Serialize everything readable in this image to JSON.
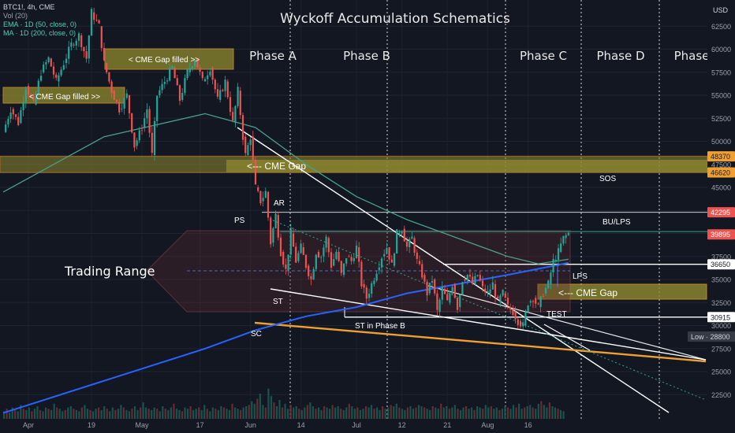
{
  "legend": {
    "symbol": "BTC1!, 4h, CME",
    "volume": "Vol (20)",
    "ema": "EMA · 1D (50, close, 0)",
    "ma": "MA · 1D (200, close, 0)",
    "currency": "USD"
  },
  "colors": {
    "background": "#131722",
    "up": "#26a69a",
    "down": "#ef5350",
    "ema": "#4a9f88",
    "ma": "#2962ff",
    "gap_fill": "#8f8a2f",
    "gap_border": "#f0a030",
    "trend_line": "#ffffff",
    "support_line": "#f0a030",
    "range_border": "#e06060"
  },
  "chart_data": {
    "type": "candlestick",
    "title": "Wyckoff Accumulation Schematics",
    "x_ticks": [
      "Apr",
      "19",
      "May",
      "17",
      "Jun",
      "14",
      "Jul",
      "12",
      "21",
      "Aug",
      "16"
    ],
    "y_ticks": [
      62500,
      60000,
      57500,
      55000,
      52500,
      50000,
      47500,
      45000,
      42500,
      40000,
      37500,
      35000,
      32500,
      30000,
      27500,
      25000,
      22500
    ],
    "y_range": [
      20000,
      65000
    ],
    "phases": [
      "Phase A",
      "Phase B",
      "Phase C",
      "Phase D",
      "Phase"
    ],
    "price_labels": [
      {
        "value": 48370,
        "text": "48370",
        "style": "orange"
      },
      {
        "value": 46620,
        "text": "46620",
        "style": "orange"
      },
      {
        "value": 42295,
        "text": "42295",
        "style": "red"
      },
      {
        "value": 39895,
        "text": "39895",
        "style": "red"
      },
      {
        "value": 36650,
        "text": "36650",
        "style": "white"
      },
      {
        "value": 30915,
        "text": "30915",
        "style": "white"
      },
      {
        "value": 28800,
        "text": "Low  ·  28800",
        "style": "grey"
      }
    ],
    "annotations": {
      "cme_gap_1": "< CME Gap filled >>",
      "cme_gap_2": "<   CME Gap filled >>",
      "cme_gap_3": "<--- CME Gap",
      "cme_gap_4": "<--- CME Gap",
      "trading_range": "Trading Range",
      "ps": "PS",
      "ar": "AR",
      "sc": "SC",
      "st": "ST",
      "st_phase_b": "ST in Phase B",
      "sos": "SOS",
      "bu_lps": "BU/LPS",
      "lps": "LPS",
      "test": "TEST"
    },
    "price_path": [
      [
        0,
        51000
      ],
      [
        3,
        53500
      ],
      [
        6,
        52000
      ],
      [
        9,
        56000
      ],
      [
        12,
        54000
      ],
      [
        15,
        57500
      ],
      [
        18,
        59000
      ],
      [
        21,
        56500
      ],
      [
        24,
        58500
      ],
      [
        27,
        60500
      ],
      [
        30,
        61500
      ],
      [
        33,
        59000
      ],
      [
        35,
        64000
      ],
      [
        38,
        62500
      ],
      [
        40,
        58500
      ],
      [
        43,
        55500
      ],
      [
        46,
        53500
      ],
      [
        49,
        55000
      ],
      [
        52,
        49500
      ],
      [
        55,
        51500
      ],
      [
        57,
        53500
      ],
      [
        59,
        48500
      ],
      [
        61,
        55000
      ],
      [
        64,
        56500
      ],
      [
        67,
        58000
      ],
      [
        70,
        54500
      ],
      [
        73,
        57500
      ],
      [
        76,
        59000
      ],
      [
        79,
        56500
      ],
      [
        82,
        58000
      ],
      [
        85,
        54500
      ],
      [
        88,
        56500
      ],
      [
        91,
        52000
      ],
      [
        93,
        55500
      ],
      [
        95,
        50500
      ],
      [
        96,
        48500
      ],
      [
        98,
        50500
      ],
      [
        100,
        45000
      ],
      [
        102,
        43500
      ],
      [
        104,
        44500
      ],
      [
        106,
        39000
      ],
      [
        108,
        42000
      ],
      [
        110,
        38000
      ],
      [
        112,
        36000
      ],
      [
        114,
        40000
      ],
      [
        116,
        37000
      ],
      [
        118,
        38500
      ],
      [
        120,
        36500
      ],
      [
        122,
        35000
      ],
      [
        124,
        38000
      ],
      [
        126,
        37500
      ],
      [
        128,
        39500
      ],
      [
        130,
        36500
      ],
      [
        132,
        38000
      ],
      [
        134,
        35500
      ],
      [
        136,
        37500
      ],
      [
        138,
        37000
      ],
      [
        140,
        38500
      ],
      [
        142,
        34500
      ],
      [
        144,
        33000
      ],
      [
        146,
        34500
      ],
      [
        148,
        36000
      ],
      [
        150,
        37500
      ],
      [
        152,
        38500
      ],
      [
        154,
        36500
      ],
      [
        156,
        40000
      ],
      [
        158,
        40500
      ],
      [
        160,
        38500
      ],
      [
        162,
        39500
      ],
      [
        164,
        37000
      ],
      [
        166,
        35500
      ],
      [
        168,
        33500
      ],
      [
        170,
        35000
      ],
      [
        172,
        31500
      ],
      [
        174,
        34000
      ],
      [
        176,
        32500
      ],
      [
        178,
        34500
      ],
      [
        180,
        32000
      ],
      [
        182,
        35000
      ],
      [
        184,
        35500
      ],
      [
        186,
        34500
      ],
      [
        188,
        35500
      ],
      [
        190,
        34000
      ],
      [
        192,
        33500
      ],
      [
        194,
        34500
      ],
      [
        196,
        32500
      ],
      [
        198,
        33500
      ],
      [
        200,
        32000
      ],
      [
        202,
        31500
      ],
      [
        204,
        30500
      ],
      [
        206,
        30000
      ],
      [
        208,
        32500
      ],
      [
        210,
        33000
      ],
      [
        212,
        32000
      ],
      [
        214,
        33500
      ],
      [
        216,
        34500
      ],
      [
        218,
        37000
      ],
      [
        220,
        38000
      ],
      [
        222,
        39500
      ],
      [
        224,
        40000
      ]
    ],
    "ema_path": [
      [
        0,
        44500
      ],
      [
        40,
        50500
      ],
      [
        80,
        53000
      ],
      [
        100,
        51500
      ],
      [
        120,
        47500
      ],
      [
        140,
        44000
      ],
      [
        160,
        41500
      ],
      [
        180,
        39500
      ],
      [
        200,
        37500
      ],
      [
        212,
        36700
      ],
      [
        224,
        37200
      ]
    ],
    "ma_path": [
      [
        0,
        20500
      ],
      [
        40,
        24000
      ],
      [
        80,
        27500
      ],
      [
        100,
        29500
      ],
      [
        120,
        31000
      ],
      [
        140,
        32000
      ],
      [
        160,
        33500
      ],
      [
        180,
        34500
      ],
      [
        200,
        35500
      ],
      [
        224,
        36800
      ]
    ],
    "x_tick_bars": [
      10,
      35,
      55,
      78,
      98,
      118,
      140,
      158,
      176,
      192,
      208
    ],
    "volume_bars": [
      6,
      8,
      5,
      9,
      7,
      6,
      11,
      8,
      7,
      9,
      6,
      8,
      10,
      7,
      6,
      9,
      8,
      7,
      12,
      9,
      8,
      6,
      7,
      9,
      10,
      8,
      7,
      6,
      9,
      11,
      8,
      7,
      6,
      8,
      9,
      7,
      10,
      8,
      6,
      9,
      7,
      8,
      11,
      9,
      7,
      6,
      8,
      10,
      7,
      9,
      13,
      9,
      8,
      7,
      9,
      8,
      6,
      10,
      8,
      7,
      9,
      12,
      8,
      7,
      6,
      9,
      8,
      10,
      7,
      8,
      9,
      7,
      11,
      8,
      6,
      9,
      8,
      7,
      10,
      9,
      8,
      7,
      12,
      9,
      8,
      7,
      9,
      10,
      11,
      14,
      12,
      16,
      20,
      11,
      9,
      24,
      18,
      13,
      10,
      15,
      9,
      12,
      8,
      11,
      9,
      10,
      8,
      7,
      9,
      11,
      13,
      10,
      8,
      9,
      7,
      10,
      9,
      8,
      11,
      9,
      10,
      8,
      7,
      9,
      12,
      10,
      8,
      9,
      7,
      8,
      10,
      9,
      11,
      8,
      9,
      7,
      10,
      8,
      9,
      11,
      10,
      12,
      9,
      8,
      7,
      9,
      10,
      8,
      9,
      11,
      10,
      9,
      8,
      7,
      10,
      9,
      8,
      12,
      9,
      10,
      8,
      9,
      11,
      8,
      7,
      9,
      10,
      8,
      9,
      7,
      10,
      9,
      8,
      11,
      9,
      10,
      8,
      9,
      7,
      8,
      10,
      9,
      8,
      11,
      9,
      12,
      8,
      9,
      10,
      11,
      9,
      8,
      12,
      14,
      11,
      9,
      13,
      10,
      9,
      8,
      7,
      6
    ]
  }
}
